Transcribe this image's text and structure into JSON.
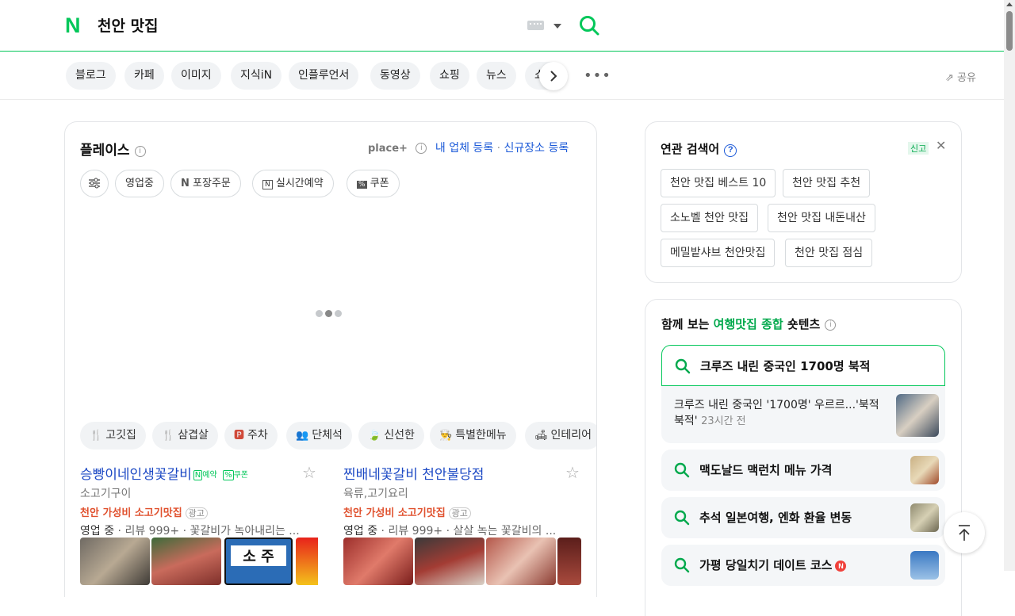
{
  "header": {
    "logo": "N",
    "query": "천안 맛집"
  },
  "tabs": [
    "블로그",
    "카페",
    "이미지",
    "지식iN",
    "인플루언서",
    "동영상",
    "쇼핑",
    "뉴스",
    "쇼"
  ],
  "share_label": "공유",
  "place": {
    "title": "플레이스",
    "logo": "place+",
    "link_register": "내 업체 등록",
    "link_new": "신규장소 등록",
    "filters": [
      "영업중",
      "포장주문",
      "실시간예약",
      "쿠폰"
    ],
    "themes": [
      {
        "icon": "🍴",
        "label": "고깃집"
      },
      {
        "icon": "🍴",
        "label": "삼겹살"
      },
      {
        "icon": "🅿",
        "label": "주차"
      },
      {
        "icon": "👥",
        "label": "단체석"
      },
      {
        "icon": "🍃",
        "label": "신선한"
      },
      {
        "icon": "👨‍🍳",
        "label": "특별한메뉴"
      },
      {
        "icon": "🛋",
        "label": "인테리어"
      }
    ],
    "businesses": [
      {
        "name": "승빵이네인생꽃갈비",
        "badge_reserve": "예약",
        "badge_coupon": "쿠폰",
        "category": "소고기구이",
        "ad_text": "천안 가성비 소고기맛집",
        "ad_label": "광고",
        "status": "영업 중",
        "reviews": "리뷰 999+",
        "snippet": "꽃갈비가 녹아내리는 ...",
        "sign_text": "소 주"
      },
      {
        "name": "찐배네꽃갈비 천안불당점",
        "category": "육류,고기요리",
        "ad_text": "천안 가성비 소고기맛집",
        "ad_label": "광고",
        "status": "영업 중",
        "reviews": "리뷰 999+",
        "snippet": "살살 녹는 꽃갈비의 ..."
      }
    ]
  },
  "related": {
    "title": "연관 검색어",
    "new_label": "신고",
    "items": [
      "천안 맛집 베스트 10",
      "천안 맛집 추천",
      "소노벨 천안 맛집",
      "천안 맛집 내돈내산",
      "메밀밭샤브 천안맛집",
      "천안 맛집 점심"
    ]
  },
  "shortents": {
    "title_pre": "함께 보는 ",
    "title_hl": "여행맛집 종합",
    "title_post": " 숏텐츠",
    "keywords": [
      {
        "text": "크루즈 내린 중국인 1700명 북적"
      },
      {
        "text": "맥도날드 맥런치 메뉴 가격"
      },
      {
        "text": "추석 일본여행, 엔화 환율 변동"
      },
      {
        "text": "가평 당일치기 데이트 코스",
        "badge": "N"
      }
    ],
    "news_text": "크루즈 내린 중국인 '1700명' 우르르...'북적북적'",
    "news_time": "23시간 전"
  }
}
